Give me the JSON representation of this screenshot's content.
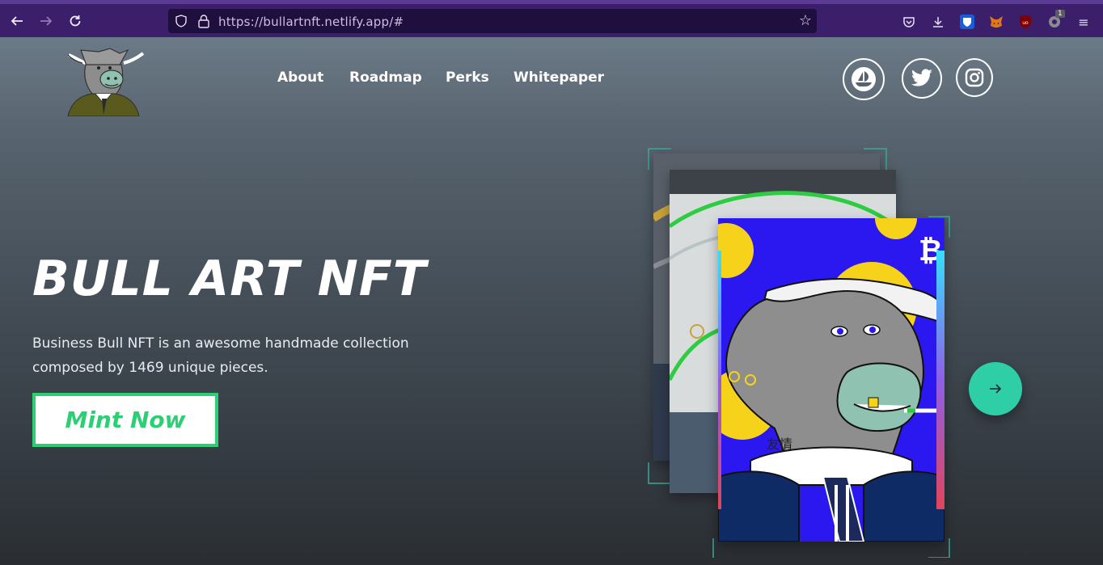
{
  "browser": {
    "url": "https://bullartnft.netlify.app/#",
    "back_icon": "arrow-left-icon",
    "forward_icon": "arrow-right-icon",
    "reload_icon": "reload-icon",
    "extension_badge": "1"
  },
  "nav": {
    "items": [
      {
        "label": "About"
      },
      {
        "label": "Roadmap"
      },
      {
        "label": "Perks"
      },
      {
        "label": "Whitepaper"
      }
    ]
  },
  "social": {
    "icons": [
      "opensea-icon",
      "twitter-icon",
      "instagram-icon"
    ]
  },
  "hero": {
    "title": "BULL ART NFT",
    "description": "Business Bull NFT is an awesome handmade collection composed by 1469 unique pieces.",
    "cta_label": "Mint Now"
  },
  "carousel": {
    "next_icon": "arrow-right-icon",
    "card_text": "友情"
  },
  "colors": {
    "accent": "#2ccf73",
    "next_button": "#2ecfa6",
    "browser_toolbar": "#3b1f6b"
  }
}
